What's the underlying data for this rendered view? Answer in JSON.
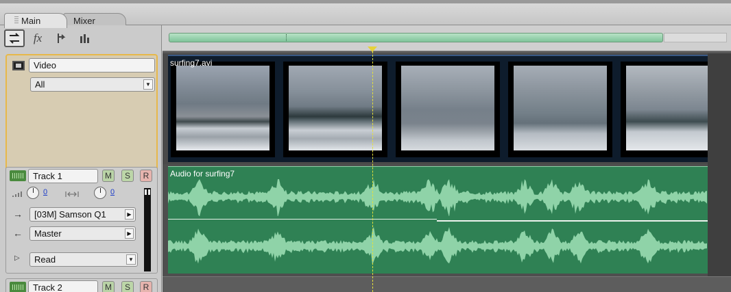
{
  "tabs": [
    {
      "label": "Main",
      "active": true
    },
    {
      "label": "Mixer",
      "active": false
    }
  ],
  "toolbar": {
    "icons": [
      "swap-icon",
      "fx-icon",
      "send-icon",
      "eq-icon"
    ],
    "fx_label": "fx"
  },
  "video_track": {
    "name": "Video",
    "display_mode": "All",
    "clip": {
      "name": "surfing7.avi"
    }
  },
  "audio_tracks": [
    {
      "name": "Track 1",
      "mute": "M",
      "solo": "S",
      "record": "R",
      "volume_value": "0",
      "pan_value": "0",
      "input": "[03M] Samson Q1",
      "output": "Master",
      "automation": "Read",
      "clip": {
        "name": "Audio for surfing7"
      }
    },
    {
      "name": "Track 2",
      "mute": "M",
      "solo": "S",
      "record": "R"
    }
  ],
  "colors": {
    "video_header_bg": "#d7ccb2",
    "video_header_border": "#e7b84a",
    "audio_clip": "#2f8154",
    "waveform": "#8fd3a8",
    "playhead": "#e6e23a",
    "zoom_bar": "#7fc49a"
  }
}
